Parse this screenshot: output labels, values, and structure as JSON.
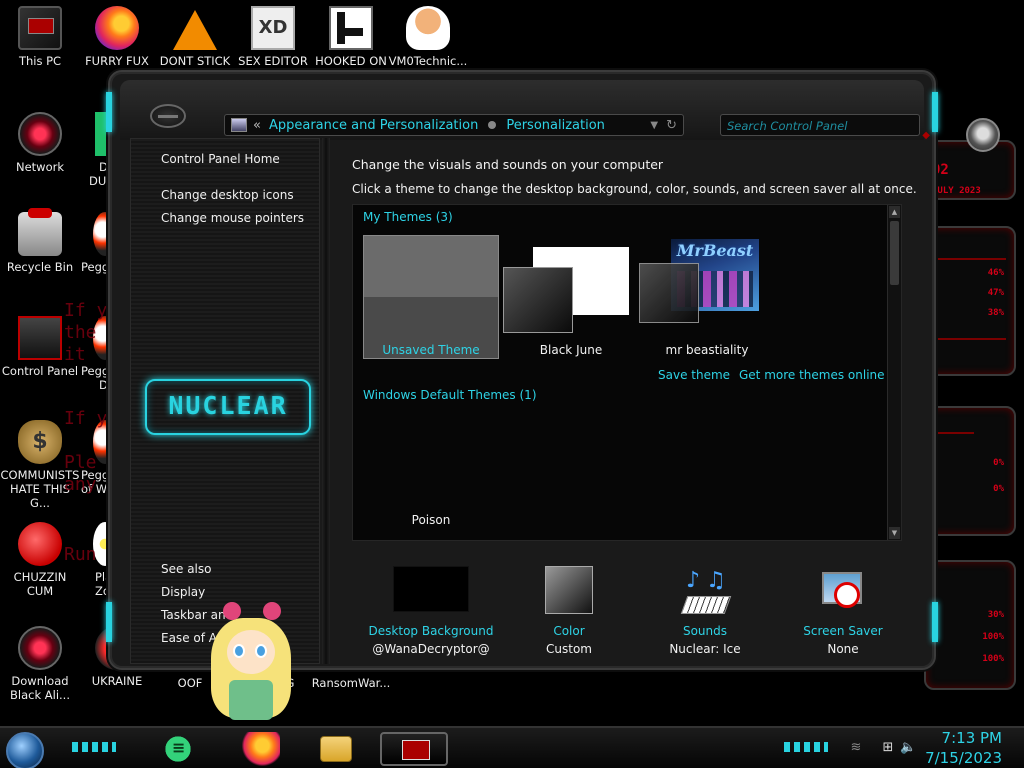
{
  "desktop": {
    "icons": [
      {
        "label": "This PC"
      },
      {
        "label": "FURRY FUX"
      },
      {
        "label": "DONT STICK"
      },
      {
        "label": "SEX EDITOR"
      },
      {
        "label": "HOOKED ON"
      },
      {
        "label": "VM0Technic..."
      },
      {
        "label": "Network"
      },
      {
        "label": "D"
      },
      {
        "label": "DUM"
      },
      {
        "label": "Recycle Bin"
      },
      {
        "label": "Peggle"
      },
      {
        "label": "Control Panel"
      },
      {
        "label": "Peggle"
      },
      {
        "label": "De"
      },
      {
        "label": "COMMUNISTS HATE THIS G..."
      },
      {
        "label": "Peggle"
      },
      {
        "label": "of Wa"
      },
      {
        "label": "CHUZZIN CUM"
      },
      {
        "label": "Plan"
      },
      {
        "label": "Zo"
      },
      {
        "label": "Download Black Ali..."
      },
      {
        "label": "UKRAINE"
      },
      {
        "label": "OOF"
      },
      {
        "label": "G"
      },
      {
        "label": "RansomWar..."
      }
    ],
    "behind_text": [
      "If y",
      "the",
      "it",
      "If y",
      "Ple",
      "any",
      "Run"
    ],
    "hud_text": [
      "02",
      "JULY 2023",
      "46%",
      "47%",
      "38%",
      "0%",
      "0%",
      "30%",
      "100%",
      "100%"
    ]
  },
  "window": {
    "address": {
      "back_chevron": "«",
      "segment_1": "Appearance and Personalization",
      "segment_2": "Personalization"
    },
    "search": {
      "placeholder": "Search Control Panel"
    },
    "sidebar": {
      "home": "Control Panel Home",
      "links": [
        "Change desktop icons",
        "Change mouse pointers"
      ],
      "brand": "NUCLEAR",
      "see_also_title": "See also",
      "see_also": [
        "Display",
        "Taskbar and",
        "Ease of Ac"
      ]
    },
    "main": {
      "heading": "Change the visuals and sounds on your computer",
      "subheading": "Click a theme to change the desktop background, color, sounds, and screen saver all at once.",
      "my_themes_title": "My Themes (3)",
      "my_themes": [
        {
          "name": "Unsaved Theme",
          "selected": true
        },
        {
          "name": "Black June",
          "selected": false
        },
        {
          "name": "mr beastiality",
          "selected": false,
          "thumb_title": "MrBeast"
        }
      ],
      "save_theme": "Save theme",
      "get_more": "Get more themes online",
      "default_themes_title": "Windows Default Themes (1)",
      "default_themes": [
        {
          "name": "Poison"
        }
      ],
      "bottom": [
        {
          "title": "Desktop Background",
          "value": "@WanaDecryptor@"
        },
        {
          "title": "Color",
          "value": "Custom"
        },
        {
          "title": "Sounds",
          "value": "Nuclear: Ice"
        },
        {
          "title": "Screen Saver",
          "value": "None"
        }
      ]
    }
  },
  "taskbar": {
    "time": "7:13 PM",
    "date": "7/15/2023"
  },
  "colors": {
    "accent_cyan": "#2ed3e6",
    "hud_red": "#d40018",
    "window_bg": "#1a1a1a"
  }
}
